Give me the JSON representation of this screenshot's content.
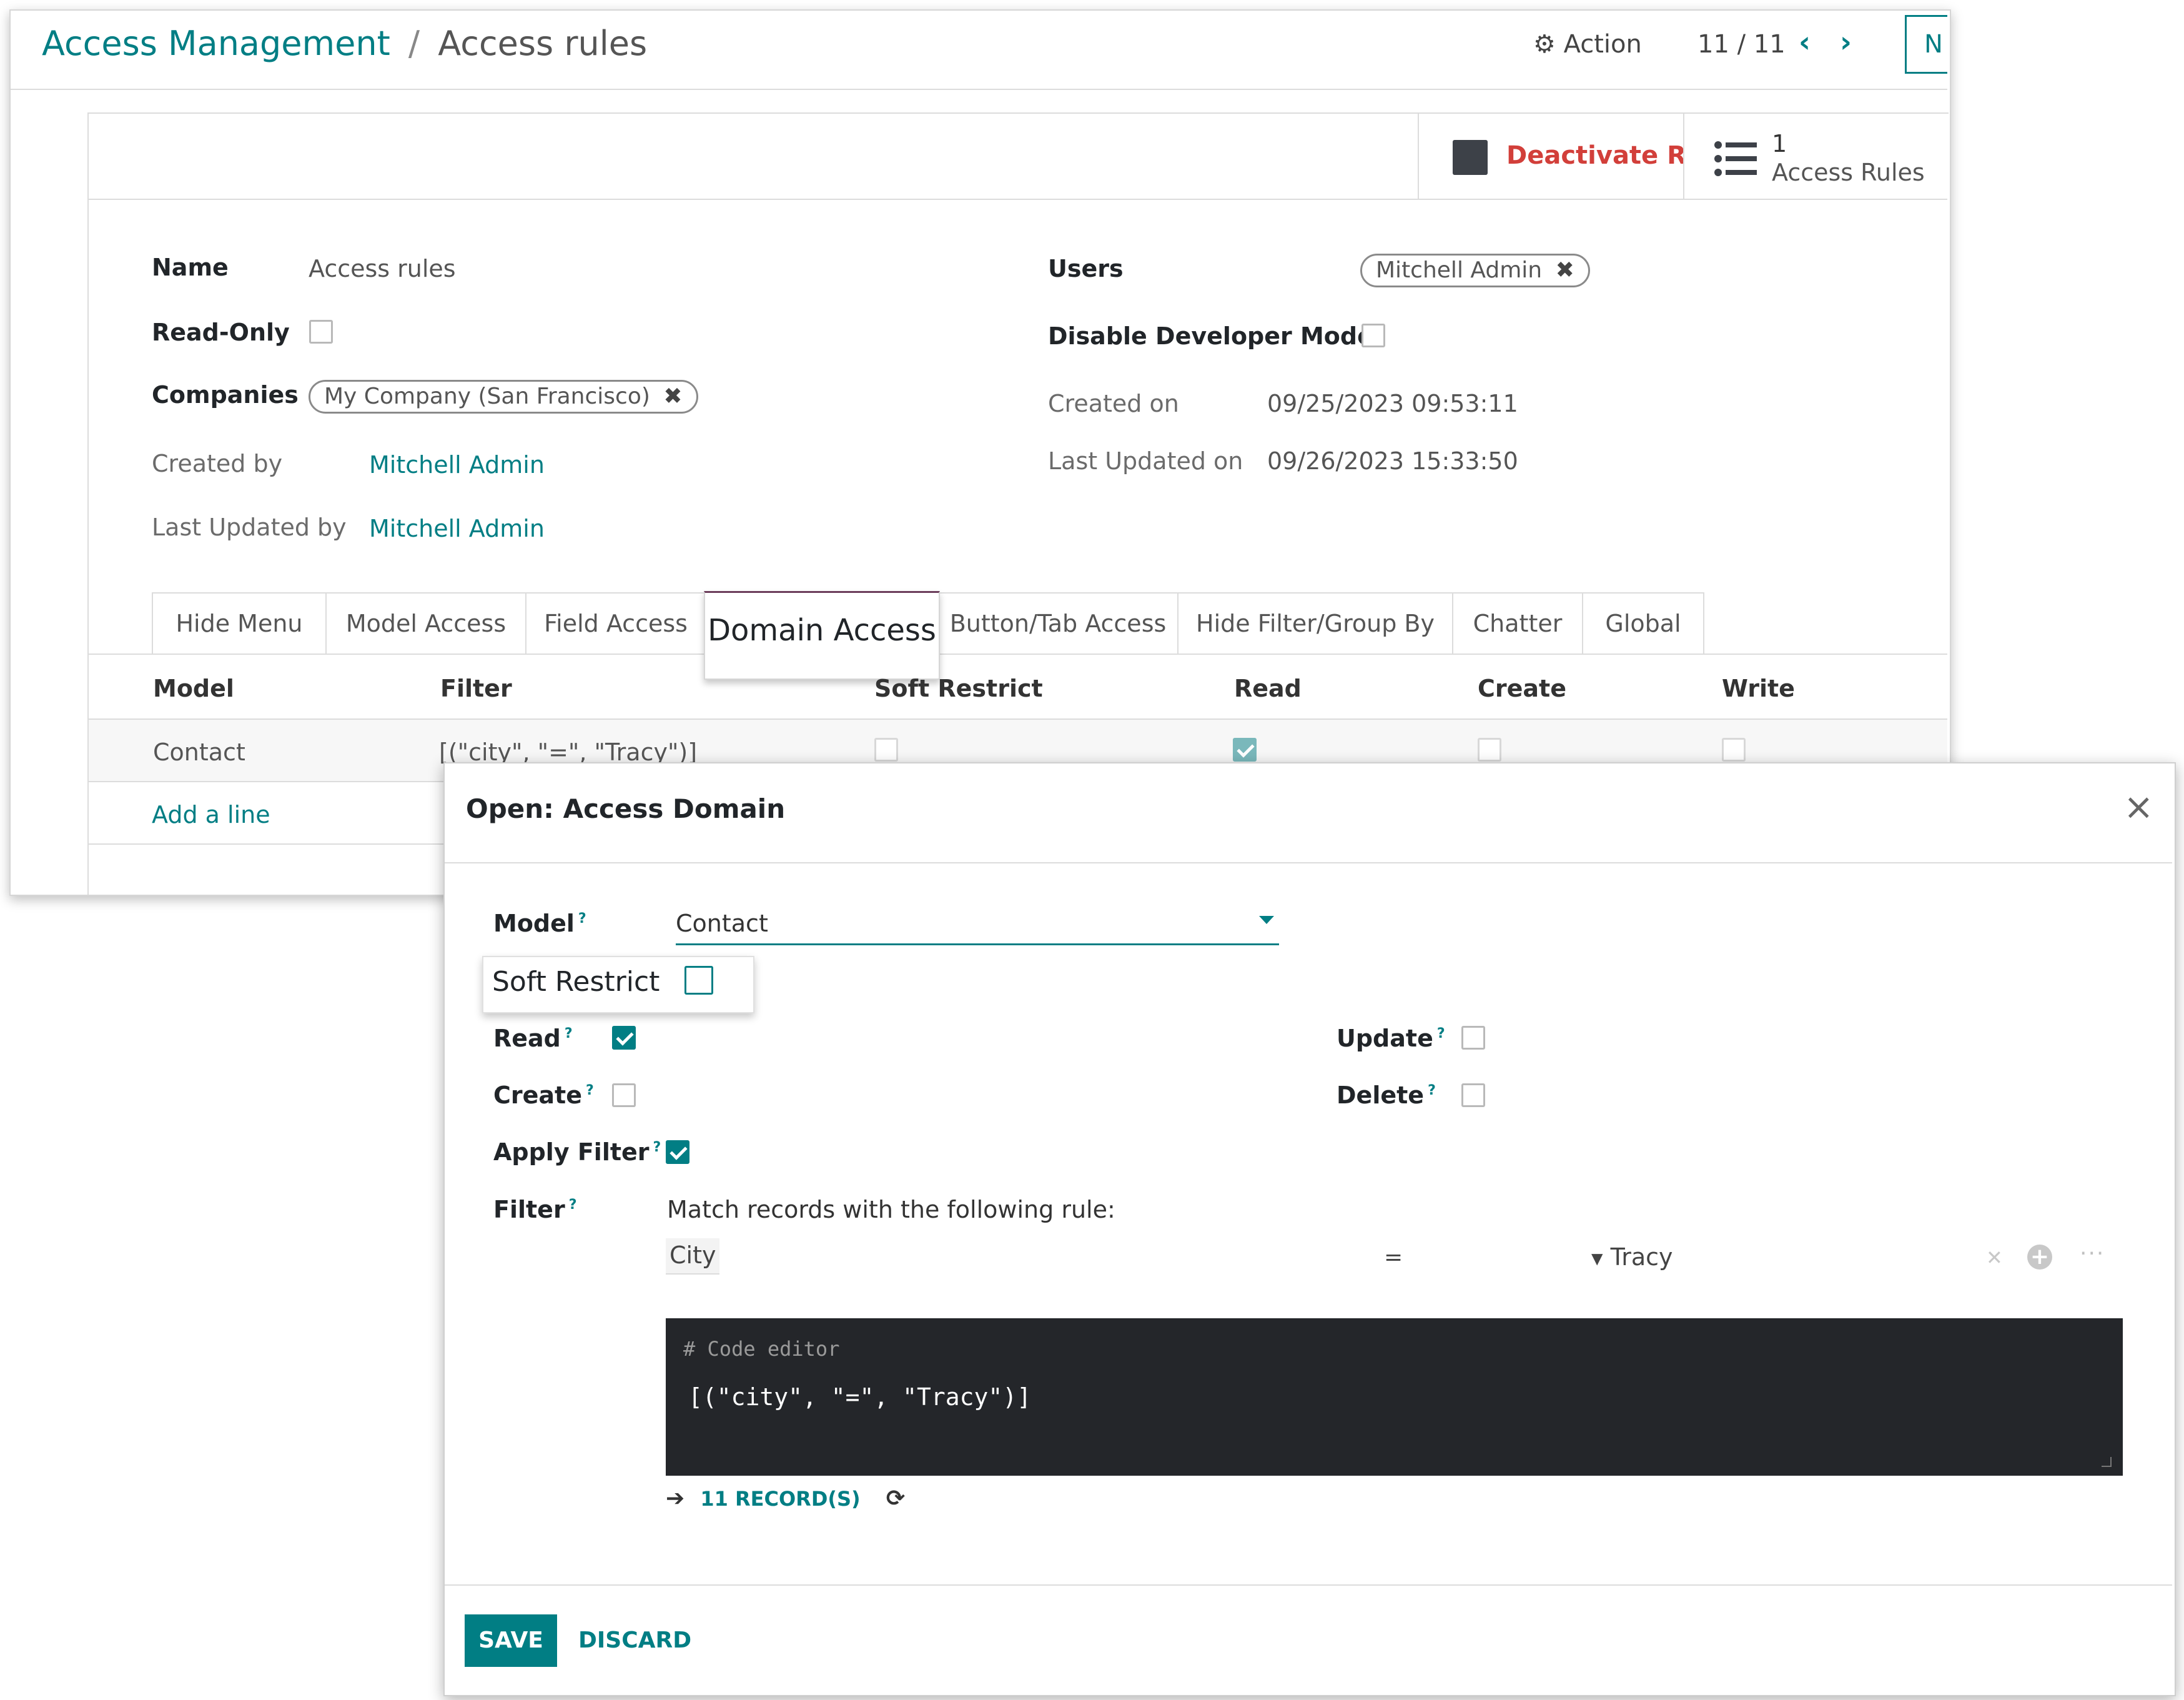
{
  "breadcrumb": {
    "parent": "Access Management",
    "separator": "/",
    "current": "Access rules"
  },
  "toolbar": {
    "action_label": "Action",
    "pager": "11 / 11",
    "new_label": "N"
  },
  "smart_buttons": {
    "deactivate_label": "Deactivate Rule",
    "rules_count": "1",
    "rules_label": "Access Rules"
  },
  "form": {
    "name_label": "Name",
    "name_value": "Access rules",
    "readonly_label": "Read-Only",
    "companies_label": "Companies",
    "company_tag": "My Company (San Francisco)",
    "created_by_label": "Created by",
    "created_by_value": "Mitchell Admin",
    "last_updated_by_label": "Last Updated by",
    "last_updated_by_value": "Mitchell Admin",
    "users_label": "Users",
    "user_tag": "Mitchell Admin",
    "disable_dev_label": "Disable Developer Mode",
    "created_on_label": "Created on",
    "created_on_value": "09/25/2023 09:53:11",
    "last_updated_on_label": "Last Updated on",
    "last_updated_on_value": "09/26/2023 15:33:50"
  },
  "tabs": [
    "Hide Menu",
    "Model Access",
    "Field Access",
    "Domain Access",
    "Button/Tab Access",
    "Hide Filter/Group By",
    "Chatter",
    "Global"
  ],
  "table": {
    "headers": [
      "Model",
      "Filter",
      "Soft Restrict",
      "Read",
      "Create",
      "Write"
    ],
    "rows": [
      {
        "model": "Contact",
        "filter": "[(\"city\", \"=\", \"Tracy\")]",
        "soft_restrict": false,
        "read": true,
        "create": false,
        "write": false
      }
    ],
    "add_line": "Add a line"
  },
  "dialog": {
    "title": "Open: Access Domain",
    "model_label": "Model",
    "model_value": "Contact",
    "soft_restrict_label": "Soft Restrict",
    "read_label": "Read",
    "read_checked": true,
    "update_label": "Update",
    "update_checked": false,
    "create_label": "Create",
    "create_checked": false,
    "delete_label": "Delete",
    "delete_checked": false,
    "apply_filter_label": "Apply Filter",
    "apply_filter_checked": true,
    "filter_label": "Filter",
    "match_text": "Match records with the following rule:",
    "rule_field": "City",
    "rule_operator": "=",
    "rule_value": "Tracy",
    "code_comment": "# Code editor",
    "code_text": "[(\"city\", \"=\", \"Tracy\")]",
    "records_text": "11 RECORD(S)",
    "save_label": "SAVE",
    "discard_label": "DISCARD"
  },
  "colors": {
    "accent": "#017e84",
    "danger": "#d23f3a",
    "editor_bg": "#24262a"
  }
}
